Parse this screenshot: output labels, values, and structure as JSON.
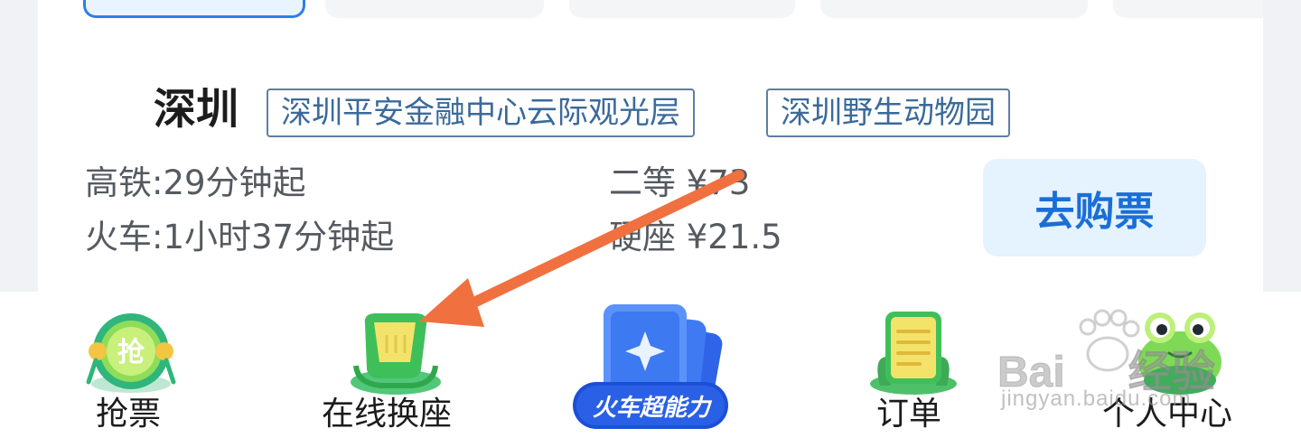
{
  "destination": {
    "city": "深圳",
    "tags": [
      "深圳平安金融中心云际观光层",
      "深圳野生动物园"
    ]
  },
  "transport": {
    "high_speed": "高铁:29分钟起",
    "train": "火车:1小时37分钟起",
    "second_class": "二等 ¥73",
    "hard_seat": "硬座 ¥21.5"
  },
  "buy_button": {
    "label": "去购票"
  },
  "bottom_nav": {
    "grab": {
      "label": "抢票",
      "icon_text": "抢"
    },
    "seat_change": {
      "label": "在线换座"
    },
    "super": {
      "badge": "火车超能力"
    },
    "orders": {
      "label": "订单"
    },
    "profile": {
      "label": "个人中心"
    }
  },
  "watermark": {
    "brand": "Bai",
    "brand_cn": "经验",
    "url": "jingyan.baidu.com"
  },
  "colors": {
    "accent": "#1a6fd6",
    "tag_border": "#5d7fa3",
    "arrow": "#f07040",
    "buy_bg": "#e5f2ff"
  }
}
